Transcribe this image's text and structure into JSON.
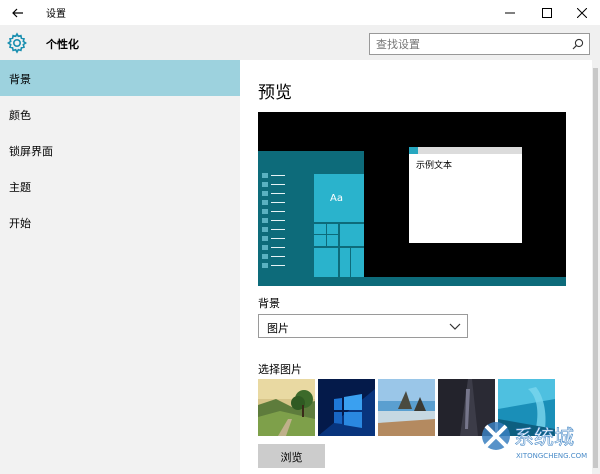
{
  "window": {
    "title": "设置"
  },
  "header": {
    "title": "个性化",
    "search_placeholder": "查找设置"
  },
  "sidebar": {
    "items": [
      {
        "label": "背景",
        "active": true
      },
      {
        "label": "颜色",
        "active": false
      },
      {
        "label": "锁屏界面",
        "active": false
      },
      {
        "label": "主题",
        "active": false
      },
      {
        "label": "开始",
        "active": false
      }
    ]
  },
  "main": {
    "preview_heading": "预览",
    "preview_sample_text": "示例文本",
    "preview_tile_label": "Aa",
    "background_label": "背景",
    "background_value": "图片",
    "choose_picture_label": "选择图片",
    "browse_label": "浏览",
    "thumbnails": [
      "landscape",
      "windows-logo",
      "beach",
      "dark-rock",
      "underwater"
    ]
  },
  "watermark": {
    "text": "系统城",
    "subtext": "XITONGCHENG.COM"
  },
  "colors": {
    "accent": "#27a7c0",
    "selected_item": "#9dd2de",
    "start_menu": "#0d6b7a"
  },
  "icons": [
    "back-arrow-icon",
    "minimize-icon",
    "maximize-icon",
    "close-icon",
    "gear-icon",
    "search-icon",
    "chevron-down-icon"
  ]
}
